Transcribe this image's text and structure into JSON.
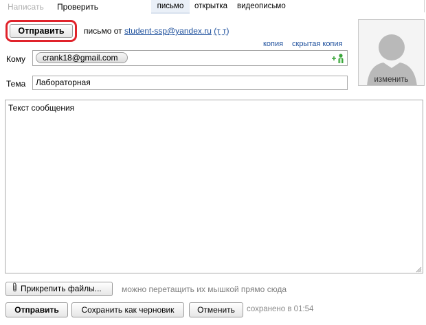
{
  "topbar": {
    "compose": "Написать",
    "check": "Проверить",
    "tabs": [
      "письмо",
      "открытка",
      "видеописьмо"
    ],
    "active_tab": "письмо"
  },
  "header": {
    "send_label": "Отправить",
    "from_prefix": "письмо от",
    "from_email": "student-ssp@yandex.ru",
    "from_extra": "(т т)",
    "cc_label": "копия",
    "bcc_label": "скрытая копия"
  },
  "to": {
    "label": "Кому",
    "recipients": [
      "crank18@gmail.com"
    ],
    "add_contact_icon": "add-contact-icon"
  },
  "subject": {
    "label": "Тема",
    "value": "Лабораторная"
  },
  "avatar": {
    "change_label": "изменить",
    "icon": "user-silhouette-icon"
  },
  "message": {
    "body": "Текст сообщения"
  },
  "attachments": {
    "button_label": "Прикрепить файлы...",
    "hint": "можно перетащить их мышкой прямо сюда",
    "icon": "paperclip-icon"
  },
  "footer": {
    "send_label": "Отправить",
    "save_draft_label": "Сохранить как черновик",
    "cancel_label": "Отменить",
    "saved_status": "сохранено в 01:54"
  },
  "colors": {
    "link": "#1d4f9c",
    "highlight_ring": "#e0232b",
    "add_contact": "#3aa53a"
  }
}
